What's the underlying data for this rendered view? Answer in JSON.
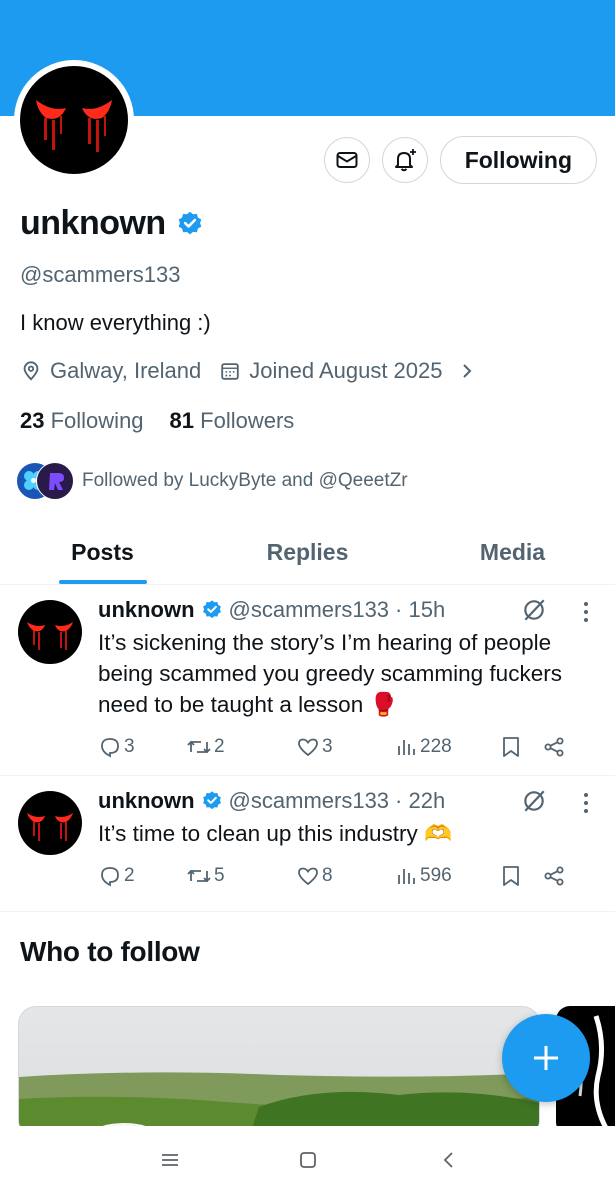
{
  "profile": {
    "name": "unknown",
    "handle": "@scammers133",
    "bio": "I know everything :)",
    "location": "Galway, Ireland",
    "joined": "Joined August 2025",
    "following_count": "23",
    "following_label": "Following",
    "followers_count": "81",
    "followers_label": "Followers",
    "followed_by": "Followed by LuckyByte and @QeeetZr",
    "follow_button": "Following"
  },
  "tabs": [
    {
      "label": "Posts",
      "active": true
    },
    {
      "label": "Replies",
      "active": false
    },
    {
      "label": "Media",
      "active": false
    }
  ],
  "posts": [
    {
      "name": "unknown",
      "handle": "@scammers133",
      "time": "· 15h",
      "text": "It’s sickening the story’s I’m hearing of people being scammed you greedy scamming fuckers need to be taught a lesson 🥊",
      "replies": "3",
      "reposts": "2",
      "likes": "3",
      "views": "228"
    },
    {
      "name": "unknown",
      "handle": "@scammers133",
      "time": "· 22h",
      "text": "It’s time to clean up this industry 🫶",
      "replies": "2",
      "reposts": "5",
      "likes": "8",
      "views": "596"
    }
  ],
  "who_to_follow": {
    "title": "Who to follow"
  },
  "colors": {
    "accent": "#1d9bf0",
    "text": "#0f1419",
    "muted": "#536471",
    "border": "#cfd9de"
  }
}
